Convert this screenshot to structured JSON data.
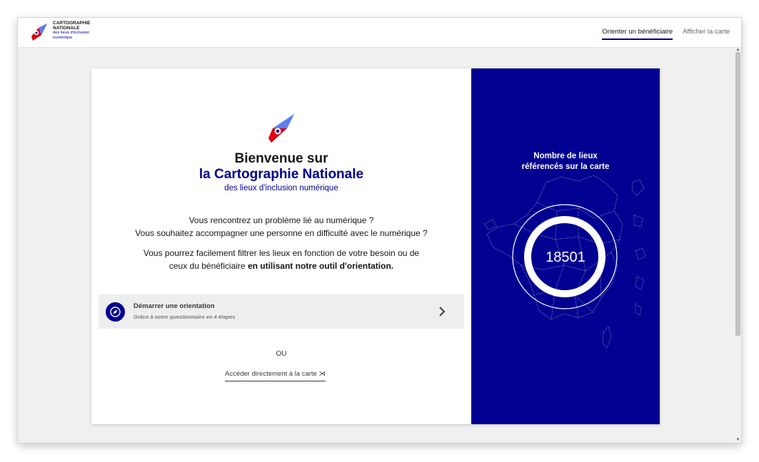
{
  "header": {
    "brand_line1": "CARTOGRAPHIE",
    "brand_line2": "NATIONALE",
    "brand_line3": "des lieux d'inclusion",
    "brand_line4": "numérique",
    "nav": [
      {
        "label": "Orienter un bénéficiaire",
        "active": true
      },
      {
        "label": "Afficher la carte",
        "active": false
      }
    ]
  },
  "welcome": {
    "line1": "Bienvenue sur",
    "line2": "la Cartographie Nationale",
    "line3": "des lieux d'inclusion numérique"
  },
  "intro": {
    "question1": "Vous rencontrez un problème lié au numérique ?",
    "question2": "Vous souhaitez accompagner une personne en difficulté avec le numérique ?",
    "info_part1": "Vous pourrez facilement filtrer les lieux en fonction de votre besoin ou de",
    "info_part2": "ceux du bénéficiaire",
    "info_bold": "en utilisant notre outil d'orientation."
  },
  "cta": {
    "title": "Démarrer une orientation",
    "subtitle": "Grâce à notre questionnaire en 4 étapes"
  },
  "separator": "OU",
  "direct_link": "Accéder directement à la carte ⋊",
  "stats": {
    "title_line1": "Nombre de lieux",
    "title_line2": "référencés sur la carte",
    "value": "18501"
  },
  "colors": {
    "brand_blue": "#000091",
    "brand_red": "#e1000f",
    "cta_background": "#eeeeee"
  }
}
